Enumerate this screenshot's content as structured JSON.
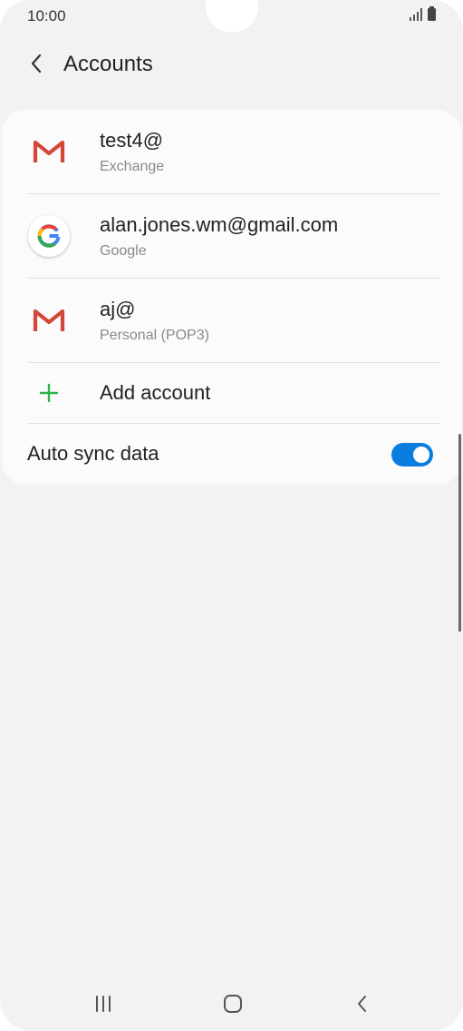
{
  "status_bar": {
    "time": "10:00"
  },
  "header": {
    "title": "Accounts"
  },
  "accounts": [
    {
      "name": "test4@",
      "type": "Exchange",
      "icon": "gmail-icon"
    },
    {
      "name": "alan.jones.wm@gmail.com",
      "type": "Google",
      "icon": "google-icon"
    },
    {
      "name": "aj@",
      "type": "Personal (POP3)",
      "icon": "gmail-icon"
    }
  ],
  "add_account": {
    "label": "Add account",
    "icon": "plus-icon"
  },
  "auto_sync": {
    "label": "Auto sync data",
    "enabled": true
  },
  "colors": {
    "accent": "#0a7ddf",
    "add_icon": "#2eb34a",
    "gmail_red": "#d44638"
  }
}
